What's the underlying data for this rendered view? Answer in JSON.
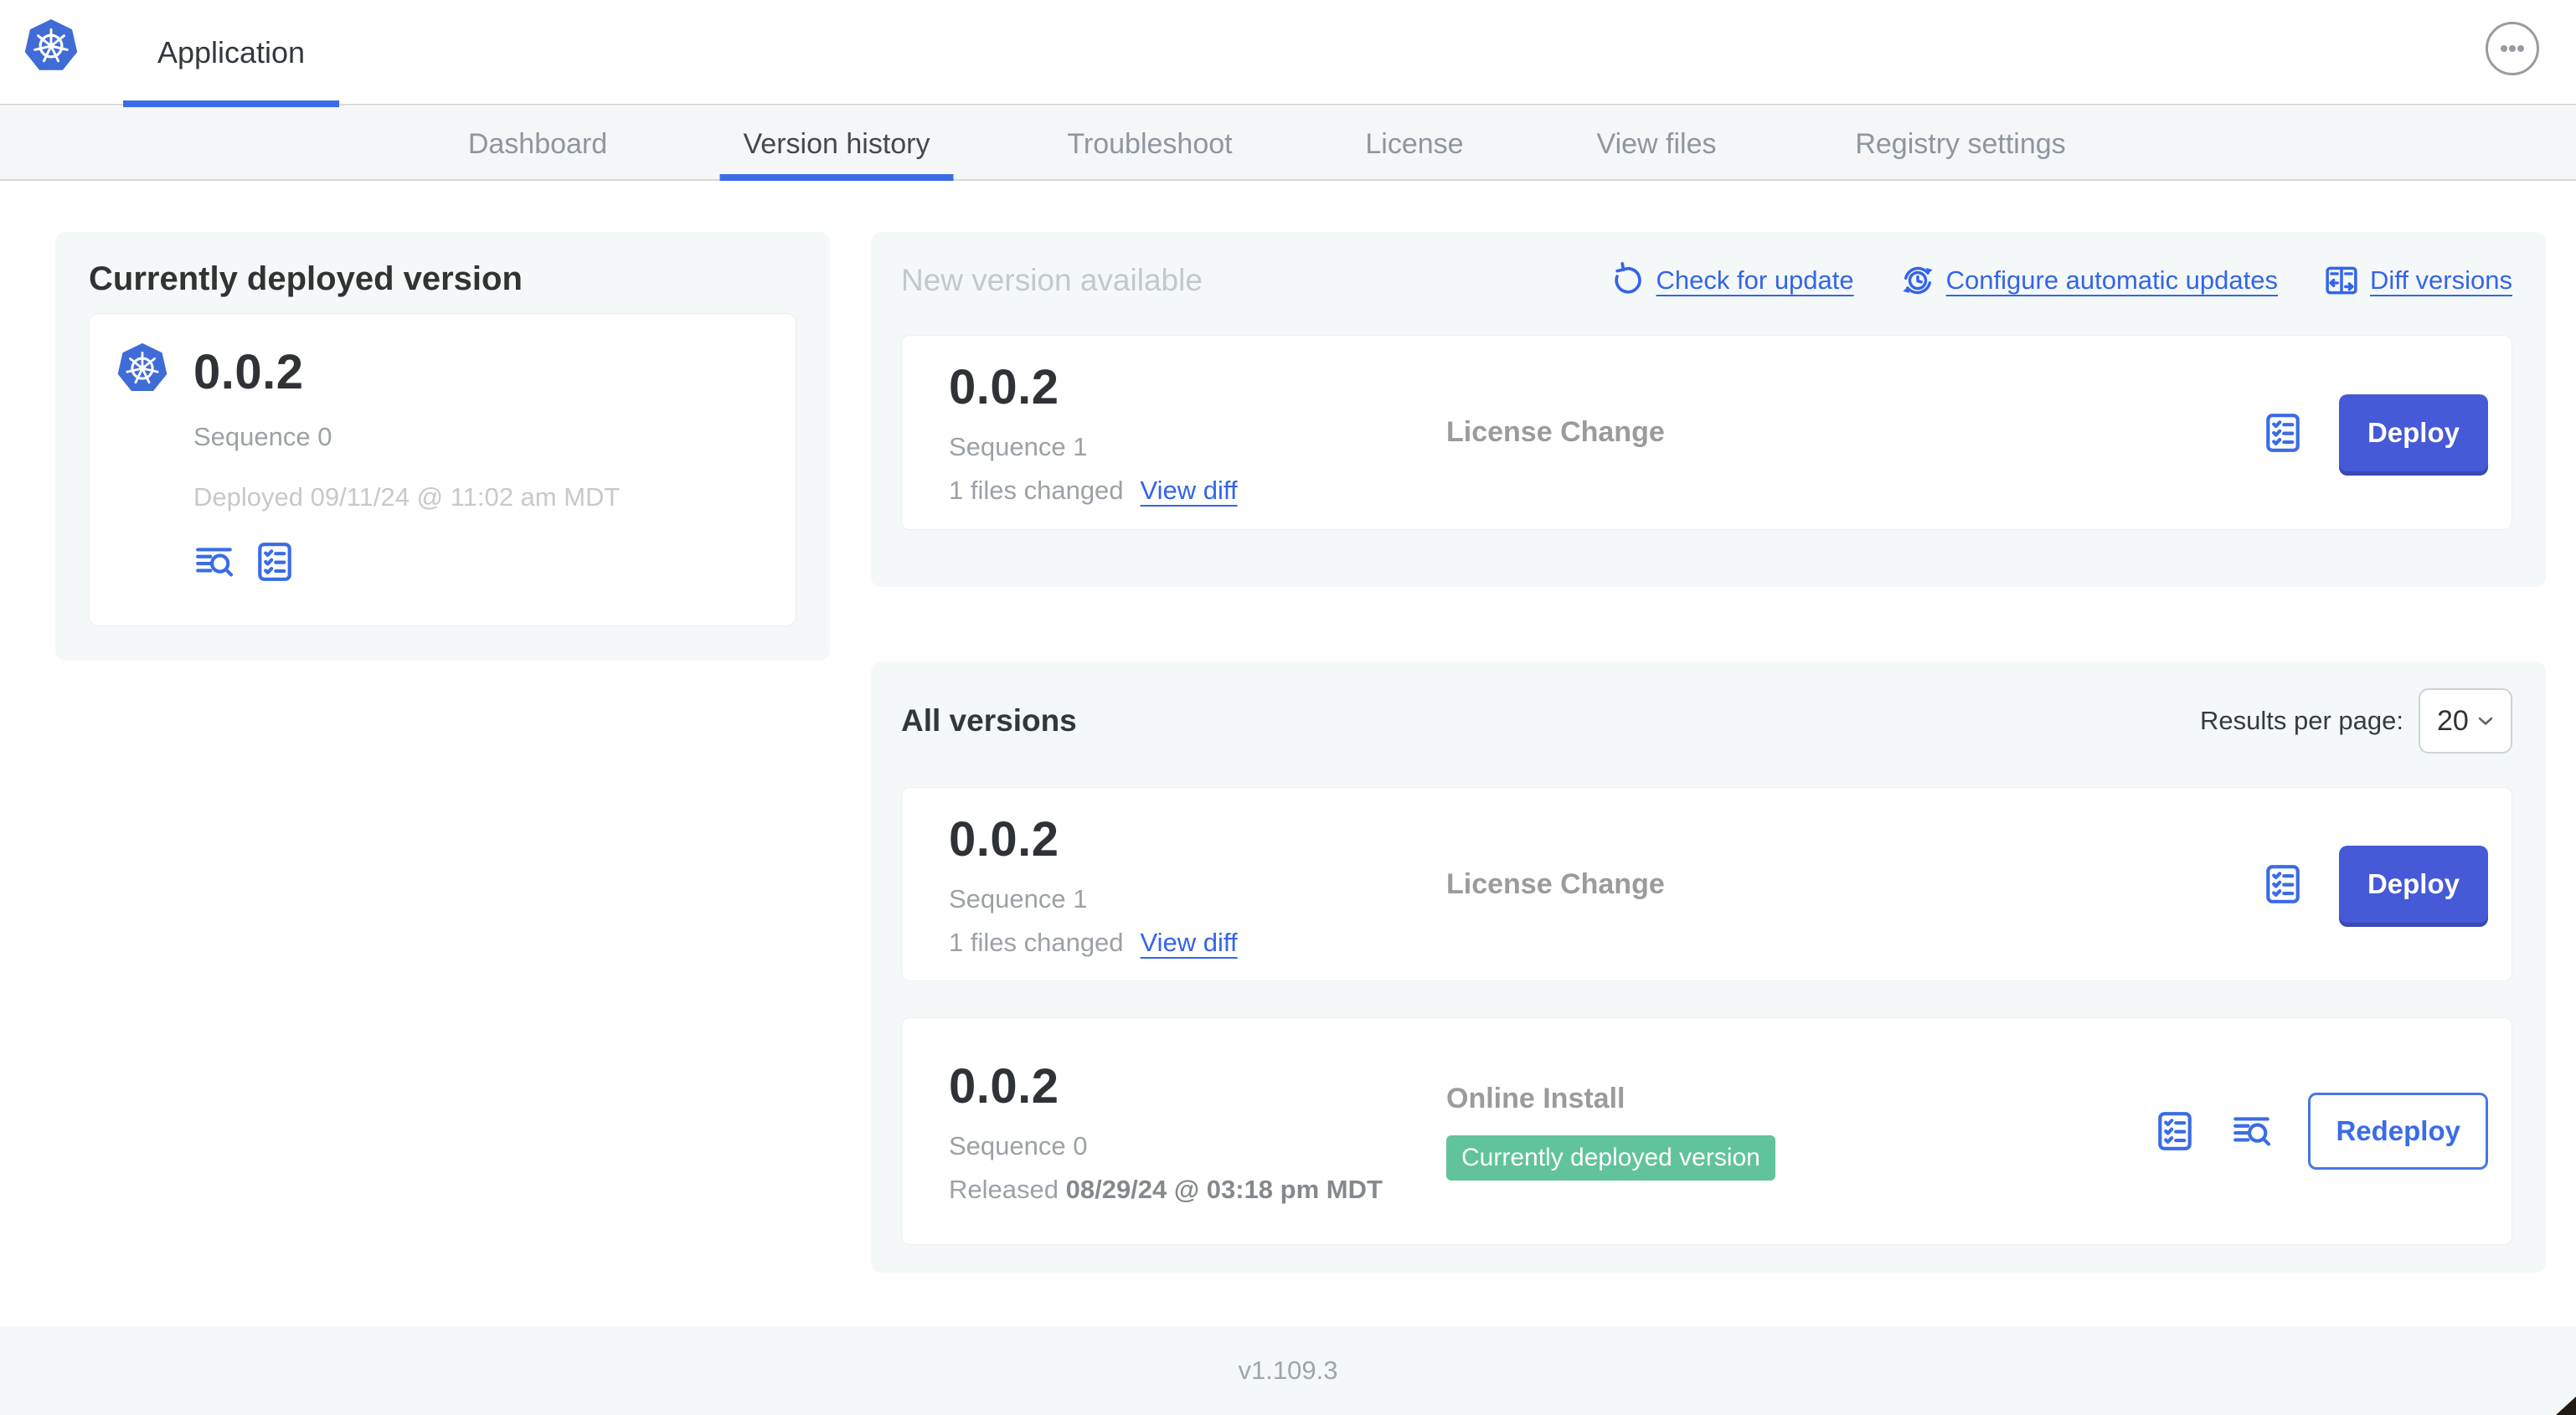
{
  "colors": {
    "brand_blue": "#3f6cd6",
    "accent_blue": "#3b6ce5",
    "link_blue": "#3464e8",
    "button_blue": "#4659d6",
    "badge_green": "#61c39b",
    "panel_gray": "#f5f8f9"
  },
  "header": {
    "title": "Application"
  },
  "nav": {
    "tabs": [
      {
        "label": "Dashboard",
        "active": false
      },
      {
        "label": "Version history",
        "active": true
      },
      {
        "label": "Troubleshoot",
        "active": false
      },
      {
        "label": "License",
        "active": false
      },
      {
        "label": "View files",
        "active": false
      },
      {
        "label": "Registry settings",
        "active": false
      }
    ]
  },
  "current_version_card": {
    "title": "Currently deployed version",
    "version": "0.0.2",
    "sequence": "Sequence 0",
    "deployed": "Deployed 09/11/24 @ 11:02 am MDT"
  },
  "new_version_panel": {
    "title": "New version available",
    "actions": [
      {
        "label": "Check for update",
        "icon": "refresh-icon"
      },
      {
        "label": "Configure automatic updates",
        "icon": "clock-update-icon"
      },
      {
        "label": "Diff versions",
        "icon": "diff-icon"
      }
    ],
    "row": {
      "version": "0.0.2",
      "sequence": "Sequence 1",
      "files_changed": "1 files changed",
      "view_diff_label": "View diff",
      "source": "License Change",
      "action_label": "Deploy"
    }
  },
  "all_versions_panel": {
    "title": "All versions",
    "results_per_page_label": "Results per page:",
    "results_per_page_value": "20",
    "rows": [
      {
        "version": "0.0.2",
        "sequence": "Sequence 1",
        "files_changed": "1 files changed",
        "view_diff_label": "View diff",
        "source": "License Change",
        "action_label": "Deploy"
      },
      {
        "version": "0.0.2",
        "sequence": "Sequence 0",
        "released_prefix": "Released",
        "released_date": "08/29/24 @ 03:18 pm MDT",
        "source": "Online Install",
        "badge": "Currently deployed version",
        "action_label": "Redeploy"
      }
    ]
  },
  "footer": {
    "version": "v1.109.3"
  }
}
